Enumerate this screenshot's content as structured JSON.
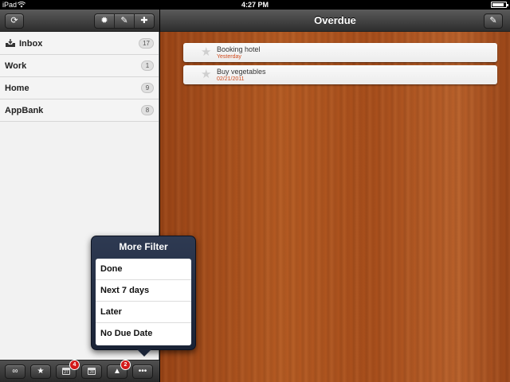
{
  "status_bar": {
    "carrier": "iPad",
    "time": "4:27 PM",
    "battery_level": 0.9
  },
  "sidebar": {
    "toolbar_buttons": [
      {
        "name": "refresh-icon",
        "glyph": "⟳"
      },
      {
        "name": "gear-icon",
        "glyph": "✹"
      },
      {
        "name": "pencil-icon",
        "glyph": "✎"
      },
      {
        "name": "plus-icon",
        "glyph": "✚"
      }
    ],
    "lists": [
      {
        "label": "Inbox",
        "count": "17",
        "icon": "inbox-icon"
      },
      {
        "label": "Work",
        "count": "1"
      },
      {
        "label": "Home",
        "count": "9"
      },
      {
        "label": "AppBank",
        "count": "8"
      }
    ]
  },
  "bottom_toolbar": {
    "buttons": [
      {
        "name": "infinity-icon",
        "glyph": "∞"
      },
      {
        "name": "star-icon",
        "glyph": "★"
      },
      {
        "name": "calendar-today-icon",
        "glyph": "27",
        "badge": "4"
      },
      {
        "name": "calendar-tomorrow-icon",
        "glyph": "28"
      },
      {
        "name": "warning-icon",
        "glyph": "▲",
        "badge": "2"
      },
      {
        "name": "more-icon",
        "glyph": "•••"
      }
    ]
  },
  "main": {
    "title": "Overdue",
    "edit_glyph": "✎",
    "tasks": [
      {
        "name": "Booking hotel",
        "due": "Yesterday"
      },
      {
        "name": "Buy vegetables",
        "due": "02/21/2011"
      }
    ]
  },
  "popover": {
    "title": "More Filter",
    "options": [
      "Done",
      "Next 7 days",
      "Later",
      "No Due Date"
    ]
  },
  "colors": {
    "due_text": "#d04a1c",
    "badge": "#d21a1a",
    "popover_bg": "#1a2336"
  }
}
